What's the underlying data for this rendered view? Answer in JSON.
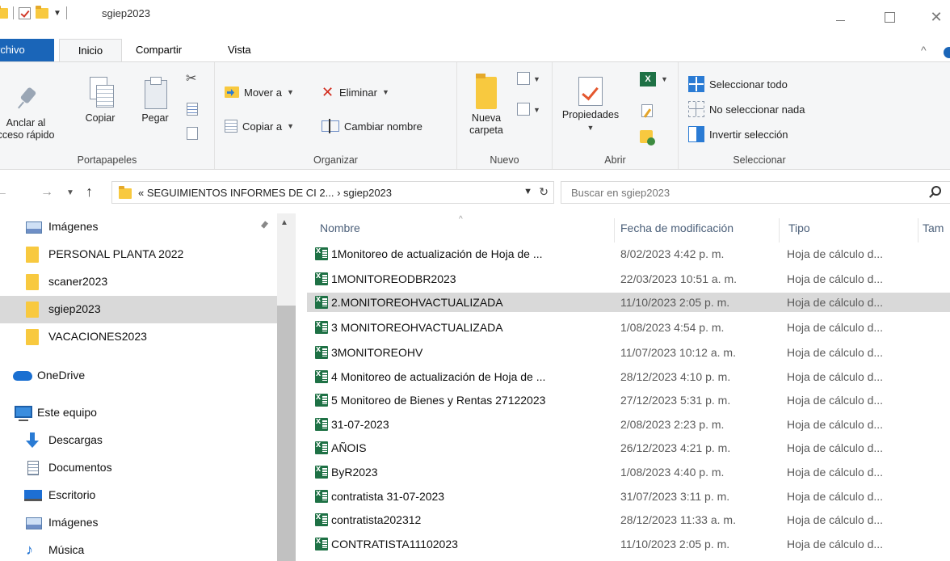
{
  "window": {
    "title": "sgiep2023",
    "controls": {
      "minimize": "—",
      "maximize": "☐",
      "close": "✕"
    }
  },
  "ribbon_tabs": [
    {
      "label": "rchivo"
    },
    {
      "label": "Inicio"
    },
    {
      "label": "Compartir"
    },
    {
      "label": "Vista"
    }
  ],
  "ribbon": {
    "portapapeles": {
      "label": "Portapapeles",
      "pin_line1": "Anclar al",
      "pin_line2": "cceso rápido",
      "copy": "Copiar",
      "paste": "Pegar"
    },
    "organizar": {
      "label": "Organizar",
      "move_to": "Mover a",
      "copy_to": "Copiar a",
      "delete": "Eliminar",
      "rename": "Cambiar nombre"
    },
    "nuevo": {
      "label": "Nuevo",
      "new_folder_line1": "Nueva",
      "new_folder_line2": "carpeta"
    },
    "abrir": {
      "label": "Abrir",
      "properties": "Propiedades"
    },
    "seleccionar": {
      "label": "Seleccionar",
      "select_all": "Seleccionar todo",
      "select_none": "No seleccionar nada",
      "invert": "Invertir selección"
    }
  },
  "address": {
    "path": "« SEGUIMIENTOS INFORMES DE CI 2...  ›  sgiep2023",
    "search_placeholder": "Buscar en sgiep2023"
  },
  "nav_pane": [
    {
      "label": "Imágenes",
      "icon": "pictures-icon",
      "pinned": true
    },
    {
      "label": "PERSONAL PLANTA 2022",
      "icon": "folder-icon"
    },
    {
      "label": "scaner2023",
      "icon": "folder-icon"
    },
    {
      "label": "sgiep2023",
      "icon": "folder-icon",
      "selected": true
    },
    {
      "label": "VACACIONES2023",
      "icon": "folder-icon"
    },
    {
      "label": "OneDrive",
      "icon": "onedrive-icon"
    },
    {
      "label": "Este equipo",
      "icon": "computer-icon"
    },
    {
      "label": "Descargas",
      "icon": "downloads-icon"
    },
    {
      "label": "Documentos",
      "icon": "documents-icon"
    },
    {
      "label": "Escritorio",
      "icon": "desktop-icon"
    },
    {
      "label": "Imágenes",
      "icon": "pictures-icon"
    },
    {
      "label": "Música",
      "icon": "music-icon"
    }
  ],
  "file_list": {
    "columns": {
      "name": "Nombre",
      "date": "Fecha de modificación",
      "type": "Tipo",
      "size": "Tam"
    },
    "rows": [
      {
        "name": "1Monitoreo de actualización de Hoja de ...",
        "date": "8/02/2023 4:42 p. m.",
        "type": "Hoja de cálculo d..."
      },
      {
        "name": "1MONITOREODBR2023",
        "date": "22/03/2023 10:51 a. m.",
        "type": "Hoja de cálculo d..."
      },
      {
        "name": "2.MONITOREOHVACTUALIZADA",
        "date": "11/10/2023 2:05 p. m.",
        "type": "Hoja de cálculo d...",
        "selected": true
      },
      {
        "name": "3 MONITOREOHVACTUALIZADA",
        "date": "1/08/2023 4:54 p. m.",
        "type": "Hoja de cálculo d..."
      },
      {
        "name": "3MONITOREOHV",
        "date": "11/07/2023 10:12 a. m.",
        "type": "Hoja de cálculo d..."
      },
      {
        "name": "4 Monitoreo de actualización de Hoja de ...",
        "date": "28/12/2023 4:10 p. m.",
        "type": "Hoja de cálculo d..."
      },
      {
        "name": "5 Monitoreo de Bienes y Rentas 27122023",
        "date": "27/12/2023 5:31 p. m.",
        "type": "Hoja de cálculo d..."
      },
      {
        "name": "31-07-2023",
        "date": "2/08/2023 2:23 p. m.",
        "type": "Hoja de cálculo d..."
      },
      {
        "name": "AÑOIS",
        "date": "26/12/2023 4:21 p. m.",
        "type": "Hoja de cálculo d..."
      },
      {
        "name": "ByR2023",
        "date": "1/08/2023 4:40 p. m.",
        "type": "Hoja de cálculo d..."
      },
      {
        "name": "contratista 31-07-2023",
        "date": "31/07/2023 3:11 p. m.",
        "type": "Hoja de cálculo d..."
      },
      {
        "name": "contratista202312",
        "date": "28/12/2023 11:33 a. m.",
        "type": "Hoja de cálculo d..."
      },
      {
        "name": "CONTRATISTA11102023",
        "date": "11/10/2023 2:05 p. m.",
        "type": "Hoja de cálculo d..."
      }
    ]
  }
}
